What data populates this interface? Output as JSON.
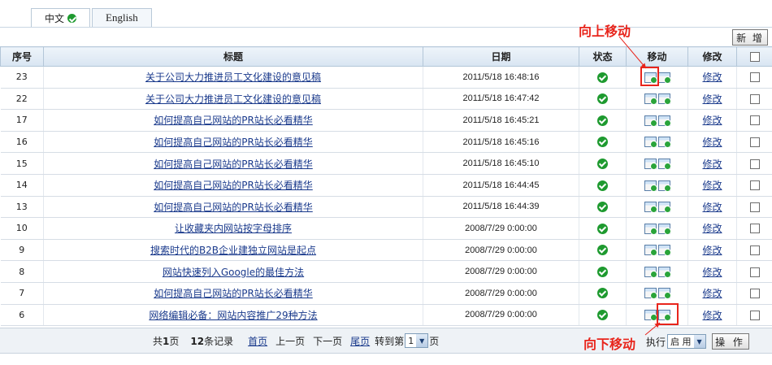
{
  "tabs": [
    {
      "label": "中文",
      "active": true
    },
    {
      "label": "English",
      "active": false
    }
  ],
  "toolbar": {
    "new_label": "新 增"
  },
  "columns": [
    "序号",
    "标题",
    "日期",
    "状态",
    "移动",
    "修改"
  ],
  "rows": [
    {
      "id": "23",
      "title": "关于公司大力推进员工文化建设的意见稿",
      "date": "2011/5/18 16:48:16",
      "edit": "修改"
    },
    {
      "id": "22",
      "title": "关于公司大力推进员工文化建设的意见稿",
      "date": "2011/5/18 16:47:42",
      "edit": "修改"
    },
    {
      "id": "17",
      "title": "如何提高自己网站的PR站长必看精华",
      "date": "2011/5/18 16:45:21",
      "edit": "修改"
    },
    {
      "id": "16",
      "title": "如何提高自己网站的PR站长必看精华",
      "date": "2011/5/18 16:45:16",
      "edit": "修改"
    },
    {
      "id": "15",
      "title": "如何提高自己网站的PR站长必看精华",
      "date": "2011/5/18 16:45:10",
      "edit": "修改"
    },
    {
      "id": "14",
      "title": "如何提高自己网站的PR站长必看精华",
      "date": "2011/5/18 16:44:45",
      "edit": "修改"
    },
    {
      "id": "13",
      "title": "如何提高自己网站的PR站长必看精华",
      "date": "2011/5/18 16:44:39",
      "edit": "修改"
    },
    {
      "id": "10",
      "title": "让收藏夹内网站按字母排序",
      "date": "2008/7/29 0:00:00",
      "edit": "修改"
    },
    {
      "id": "9",
      "title": "搜索时代的B2B企业建独立网站是起点",
      "date": "2008/7/29 0:00:00",
      "edit": "修改"
    },
    {
      "id": "8",
      "title": "网站快速列入Google的最佳方法",
      "date": "2008/7/29 0:00:00",
      "edit": "修改"
    },
    {
      "id": "7",
      "title": "如何提高自己网站的PR站长必看精华",
      "date": "2008/7/29 0:00:00",
      "edit": "修改"
    },
    {
      "id": "6",
      "title": "网络编辑必备：网站内容推广29种方法",
      "date": "2008/7/29 0:00:00",
      "edit": "修改"
    }
  ],
  "pager": {
    "total_pages_pre": "共",
    "total_pages": "1",
    "total_pages_post": "页",
    "records": "12",
    "records_post": "条记录",
    "first": "首页",
    "prev": "上一页",
    "next": "下一页",
    "last": "尾页",
    "goto_pre": "转到第",
    "goto_value": "1",
    "goto_post": "页"
  },
  "actions": {
    "exec_label": "执行",
    "exec_value": "启 用",
    "op_label": "操 作"
  },
  "annotations": {
    "move_up": "向上移动",
    "move_down": "向下移动"
  },
  "colors": {
    "annotation": "#e8251c",
    "link": "#1a3a8c",
    "status_ok": "#1e9a2f"
  }
}
